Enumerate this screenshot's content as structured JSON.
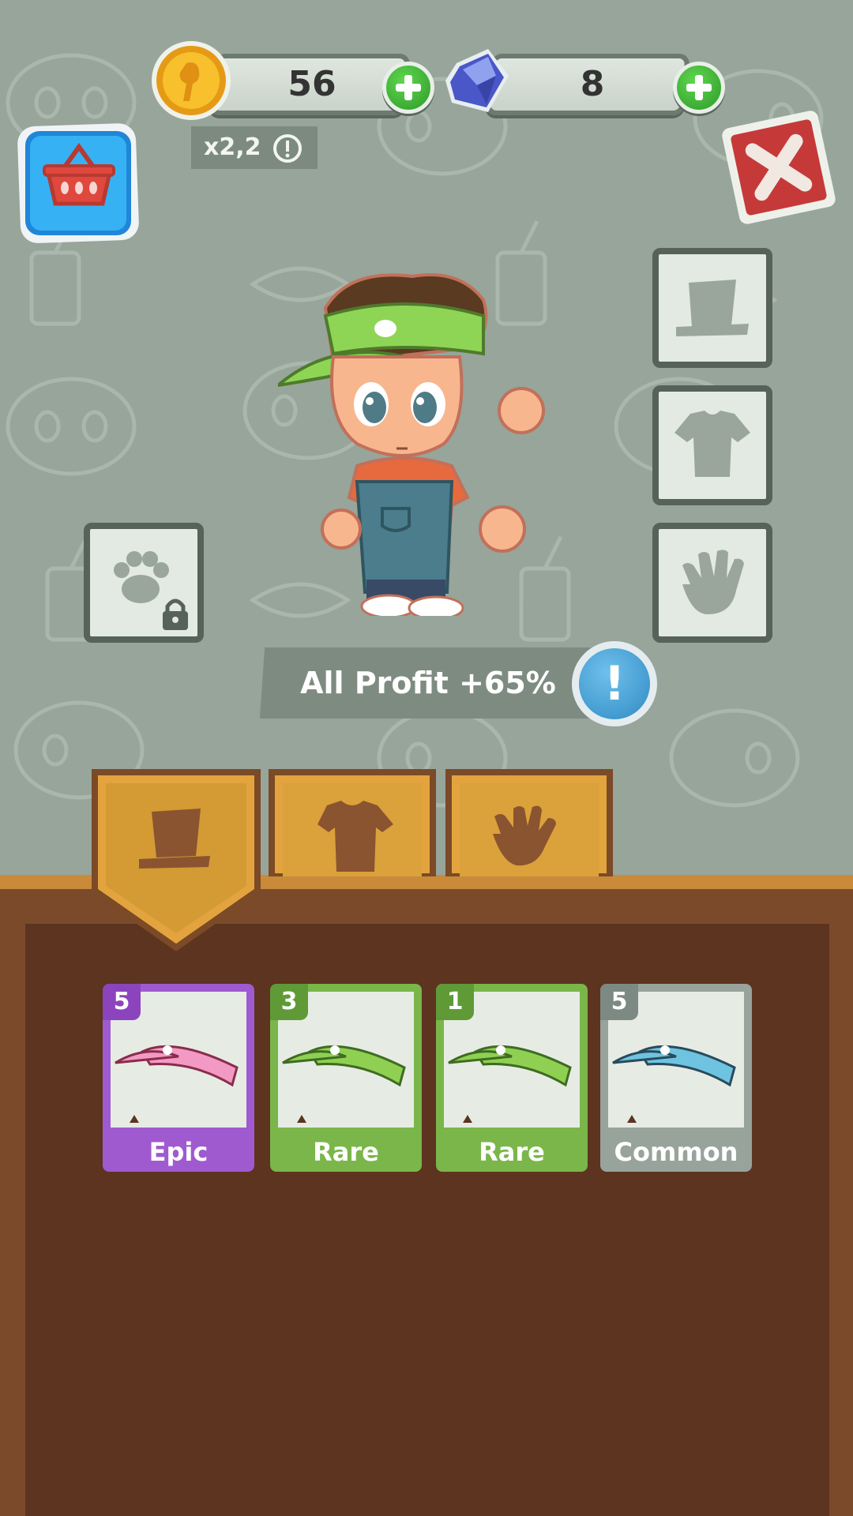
{
  "currency": {
    "coins": "56",
    "gems": "8",
    "multiplier": "x2,2"
  },
  "profit": {
    "label": "All Profit +65%"
  },
  "tabs": [
    {
      "name": "hat",
      "active": true
    },
    {
      "name": "shirt",
      "active": false
    },
    {
      "name": "gloves",
      "active": false
    }
  ],
  "items": [
    {
      "count": "5",
      "rarity": "Epic",
      "color": "#a05ad0",
      "visor": "#f29ac4"
    },
    {
      "count": "3",
      "rarity": "Rare",
      "color": "#7ab649",
      "visor": "#8fd052"
    },
    {
      "count": "1",
      "rarity": "Rare",
      "color": "#7ab649",
      "visor": "#8fd052"
    },
    {
      "count": "5",
      "rarity": "Common",
      "color": "#98a39c",
      "visor": "#6ec4e0"
    }
  ],
  "colors": {
    "background": "#97a59b",
    "tab_gold": "#e0a841",
    "floor": "#5c3420"
  }
}
